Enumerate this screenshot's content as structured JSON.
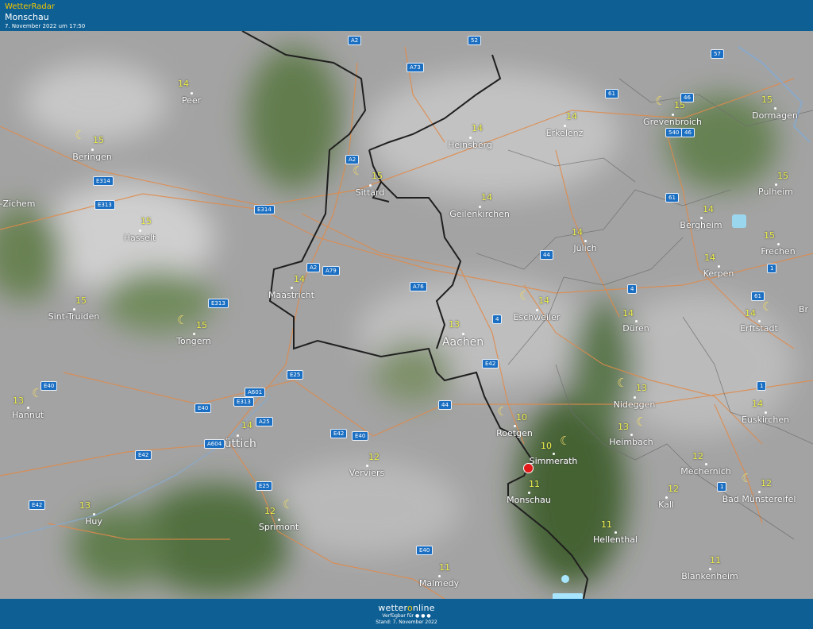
{
  "header": {
    "brand": "WetterRadar",
    "location": "Monschau",
    "timestamp": "7. November 2022 um 17:50"
  },
  "footer": {
    "logo_a": "wetter",
    "logo_o": "o",
    "logo_b": "nline",
    "available": "Verfügbar für ● ● ●",
    "stand": "Stand: 7. November 2022"
  },
  "colors": {
    "bar": "#0e5f94",
    "temp": "#eef04a",
    "border": "#222222",
    "road": "#e08a4a"
  },
  "places": [
    {
      "name": "Peer",
      "temp": "14",
      "moon": false
    },
    {
      "name": "Beringen",
      "temp": "15",
      "moon": true
    },
    {
      "name": "Hasselt",
      "temp": "15",
      "moon": false
    },
    {
      "name": "Sint-Truiden",
      "temp": "15",
      "moon": false
    },
    {
      "name": "Tongern",
      "temp": "15",
      "moon": true
    },
    {
      "name": "Hannut",
      "temp": "13",
      "moon": true
    },
    {
      "name": "Lüttich",
      "temp": "14",
      "moon": false
    },
    {
      "name": "Huy",
      "temp": "13",
      "moon": false
    },
    {
      "name": "Sprimont",
      "temp": "12",
      "moon": true
    },
    {
      "name": "Verviers",
      "temp": "12",
      "moon": false
    },
    {
      "name": "Malmedy",
      "temp": "11",
      "moon": false
    },
    {
      "name": "Maastricht",
      "temp": "14",
      "moon": false
    },
    {
      "name": "Sittard",
      "temp": "15",
      "moon": true
    },
    {
      "name": "Heinsberg",
      "temp": "14",
      "moon": false
    },
    {
      "name": "Geilenkirchen",
      "temp": "14",
      "moon": false
    },
    {
      "name": "Erkelenz",
      "temp": "14",
      "moon": false
    },
    {
      "name": "Grevenbroich",
      "temp": "15",
      "moon": true
    },
    {
      "name": "Dormagen",
      "temp": "15",
      "moon": false
    },
    {
      "name": "Pulheim",
      "temp": "15",
      "moon": false
    },
    {
      "name": "Bergheim",
      "temp": "14",
      "moon": false
    },
    {
      "name": "Frechen",
      "temp": "15",
      "moon": false
    },
    {
      "name": "Kerpen",
      "temp": "14",
      "moon": false
    },
    {
      "name": "Erftstadt",
      "temp": "14",
      "moon": true
    },
    {
      "name": "Jülich",
      "temp": "14",
      "moon": false
    },
    {
      "name": "Düren",
      "temp": "14",
      "moon": false
    },
    {
      "name": "Eschweiler",
      "temp": "14",
      "moon": true
    },
    {
      "name": "Aachen",
      "temp": "13",
      "moon": false
    },
    {
      "name": "Roetgen",
      "temp": "10",
      "moon": true
    },
    {
      "name": "Simmerath",
      "temp": "10",
      "moon": true
    },
    {
      "name": "Monschau",
      "temp": "11",
      "moon": false
    },
    {
      "name": "Nideggen",
      "temp": "13",
      "moon": true
    },
    {
      "name": "Heimbach",
      "temp": "13",
      "moon": true
    },
    {
      "name": "Euskirchen",
      "temp": "14",
      "moon": false
    },
    {
      "name": "Mechernich",
      "temp": "12",
      "moon": false
    },
    {
      "name": "Kall",
      "temp": "12",
      "moon": false
    },
    {
      "name": "Bad Münstereifel",
      "temp": "12",
      "moon": true
    },
    {
      "name": "Hellenthal",
      "temp": "11",
      "moon": false
    },
    {
      "name": "Blankenheim",
      "temp": "11",
      "moon": false
    }
  ],
  "edge_labels": [
    "-Zichem",
    "Br"
  ],
  "roads": [
    "A2",
    "A73",
    "52",
    "57",
    "46",
    "61",
    "540",
    "61",
    "46",
    "A2",
    "E314",
    "E313",
    "E314",
    "A2",
    "A79",
    "A76",
    "44",
    "4",
    "4",
    "1",
    "61",
    "E313",
    "E25",
    "A601",
    "E313",
    "E40",
    "A25",
    "A604",
    "E42",
    "E25",
    "E42",
    "E40",
    "E42",
    "E40",
    "44",
    "E42",
    "1",
    "1",
    "E40"
  ]
}
